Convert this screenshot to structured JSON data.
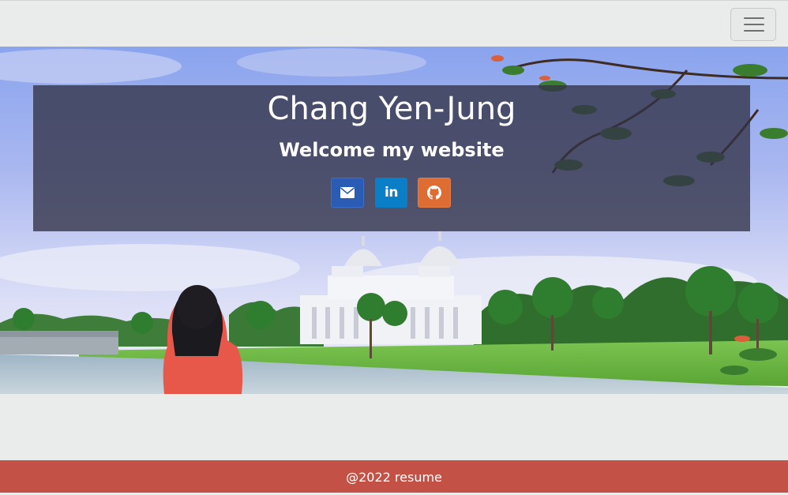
{
  "navbar": {
    "toggle_icon": "hamburger-menu-icon"
  },
  "hero": {
    "title": "Chang Yen-Jung",
    "subtitle": "Welcome my website",
    "background_image": "photo of a woman by a lake facing a white domed museum under blue sky",
    "social_links": [
      {
        "icon": "envelope-icon",
        "color": "#2a5cb4"
      },
      {
        "icon": "linkedin-icon",
        "color": "#0b7ec8"
      },
      {
        "icon": "github-icon",
        "color": "#dd6d33"
      }
    ]
  },
  "footer": {
    "text": "@2022 resume",
    "color": "#c35146"
  }
}
